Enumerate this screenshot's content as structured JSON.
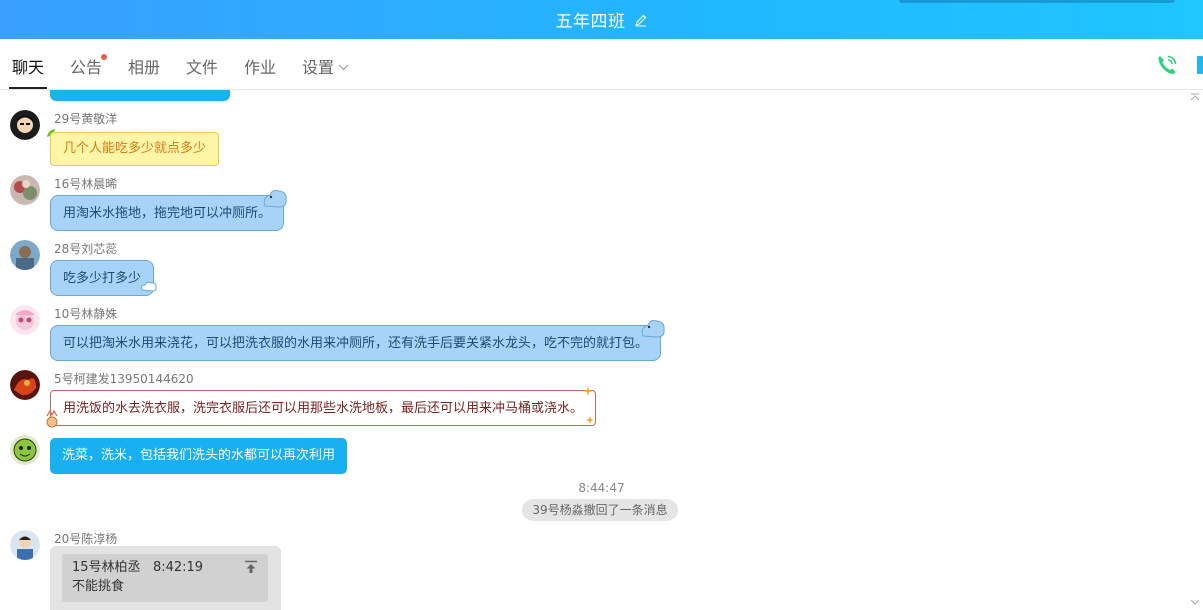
{
  "window": {
    "title": "五年四班",
    "edit_icon": "pencil-edit-icon"
  },
  "tabs": [
    {
      "label": "聊天",
      "active": true
    },
    {
      "label": "公告",
      "has_badge": true
    },
    {
      "label": "相册"
    },
    {
      "label": "文件"
    },
    {
      "label": "作业"
    },
    {
      "label": "设置",
      "has_dropdown": true
    }
  ],
  "toolbar": {
    "call_icon": "phone-icon"
  },
  "colors": {
    "title_bar": "#2aaaff",
    "accent": "#18b0f0",
    "badge": "#f25b4b"
  },
  "messages": [
    {
      "sender": "29号黄敬洋",
      "text": "几个人能吃多少就点多少",
      "style": "yellow"
    },
    {
      "sender": "16号林晨晞",
      "text": "用淘米水拖地，拖完地可以冲厕所。",
      "style": "blue"
    },
    {
      "sender": "28号刘芯蕊",
      "text": "吃多少打多少",
      "style": "blue"
    },
    {
      "sender": "10号林静姝",
      "text": "可以把淘米水用来浇花，可以把洗衣服的水用来冲厕所，还有洗手后要关紧水龙头，吃不完的就打包。",
      "style": "blue"
    },
    {
      "sender": "5号柯建发13950144620",
      "text": "用洗饭的水去洗衣服，洗完衣服后还可以用那些水洗地板，最后还可以用来冲马桶或浇水。",
      "style": "white"
    },
    {
      "sender": "",
      "text": "洗菜，洗米，包括我们洗头的水都可以再次利用",
      "style": "cyan"
    }
  ],
  "divider": {
    "time": "8:44:47",
    "recall_notice": "39号杨淼撤回了一条消息"
  },
  "last_message": {
    "sender": "20号陈淳杨",
    "quote": {
      "author": "15号林柏丞",
      "time": "8:42:19",
      "text": "不能挑食"
    }
  }
}
